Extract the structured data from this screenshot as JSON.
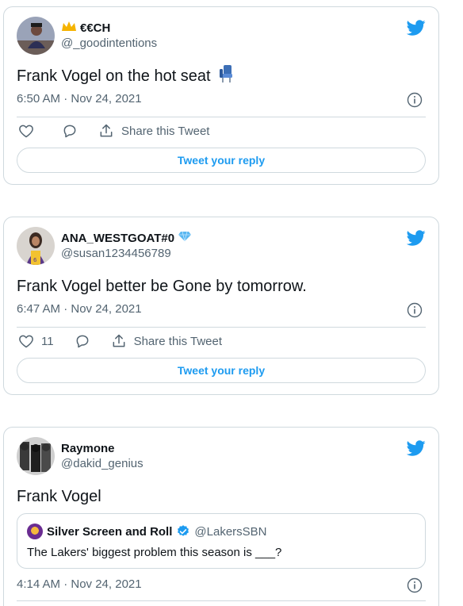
{
  "tweets": [
    {
      "display_name": "€€CH",
      "name_prefix_emoji": "crown-emoji",
      "handle": "@_goodintentions",
      "text": "Frank Vogel on the hot seat",
      "text_emoji": "seat-emoji",
      "time": "6:50 AM · Nov 24, 2021",
      "like_count": "",
      "share_label": "Share this Tweet",
      "reply_label": "Tweet your reply"
    },
    {
      "display_name": "ANA_WESTGOAT#0",
      "name_suffix_emoji": "diamond-emoji",
      "handle": "@susan1234456789",
      "text": "Frank Vogel better be Gone by tomorrow.",
      "time": "6:47 AM · Nov 24, 2021",
      "like_count": "11",
      "share_label": "Share this Tweet",
      "reply_label": "Tweet your reply"
    },
    {
      "display_name": "Raymone",
      "handle": "@dakid_genius",
      "text": "Frank Vogel",
      "quote": {
        "display_name": "Silver Screen and Roll",
        "verified": true,
        "handle": "@LakersSBN",
        "text": "The Lakers' biggest problem this season is ___?"
      },
      "time": "4:14 AM · Nov 24, 2021"
    }
  ],
  "colors": {
    "twitter_blue": "#1d9bf0",
    "text_primary": "#0f1419",
    "text_secondary": "#536471",
    "border": "#cfd9de",
    "crown_gold": "#f5b301",
    "diamond_blue": "#5ab7f0"
  },
  "icons": [
    "twitter-bird-icon",
    "info-icon",
    "heart-icon",
    "reply-icon",
    "share-icon",
    "verified-badge-icon"
  ]
}
